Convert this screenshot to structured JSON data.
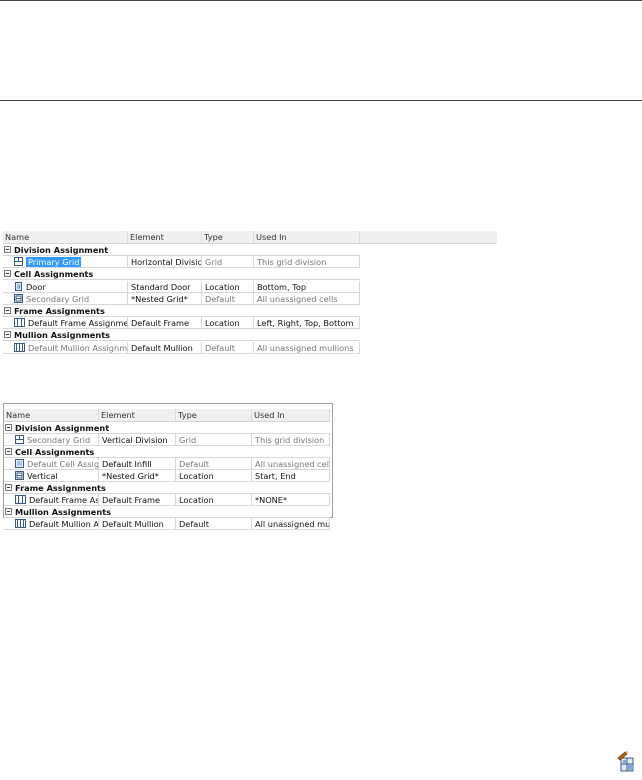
{
  "panel1": {
    "columns": [
      "Name",
      "Element",
      "Type",
      "Used In"
    ],
    "groups": [
      {
        "label": "Division Assignment",
        "rows": [
          {
            "icon": "grid-division-icon",
            "name": "Primary Grid",
            "element": "Horizontal Division",
            "type": "Grid",
            "used_in": "This grid division",
            "selected": true,
            "muted": true
          }
        ]
      },
      {
        "label": "Cell Assignments",
        "rows": [
          {
            "icon": "door-icon",
            "name": "Door",
            "element": "Standard Door",
            "type": "Location",
            "used_in": "Bottom, Top",
            "selected": false,
            "muted": false
          },
          {
            "icon": "nested-grid-icon",
            "name": "Secondary Grid",
            "element": "*Nested Grid*",
            "type": "Default",
            "used_in": "All unassigned cells",
            "selected": false,
            "muted": true
          }
        ]
      },
      {
        "label": "Frame Assignments",
        "rows": [
          {
            "icon": "frame-icon",
            "name": "Default Frame Assignment",
            "element": "Default Frame",
            "type": "Location",
            "used_in": "Left, Right, Top, Bottom",
            "selected": false,
            "muted": false
          }
        ]
      },
      {
        "label": "Mullion Assignments",
        "rows": [
          {
            "icon": "mullion-icon",
            "name": "Default Mullion Assignment",
            "element": "Default Mullion",
            "type": "Default",
            "used_in": "All unassigned mullions",
            "selected": false,
            "muted": true
          }
        ]
      }
    ]
  },
  "panel2": {
    "columns": [
      "Name",
      "Element",
      "Type",
      "Used In"
    ],
    "groups": [
      {
        "label": "Division Assignment",
        "rows": [
          {
            "icon": "grid-division-icon",
            "name": "Secondary Grid",
            "element": "Vertical Division",
            "type": "Grid",
            "used_in": "This grid division",
            "selected": false,
            "muted": true
          }
        ]
      },
      {
        "label": "Cell Assignments",
        "rows": [
          {
            "icon": "cell-icon",
            "name": "Default Cell Assignment",
            "element": "Default Infill",
            "type": "Default",
            "used_in": "All unassigned cells",
            "selected": false,
            "muted": true
          },
          {
            "icon": "nested-grid-icon",
            "name": "Vertical",
            "element": "*Nested Grid*",
            "type": "Location",
            "used_in": "Start, End",
            "selected": false,
            "muted": false
          }
        ]
      },
      {
        "label": "Frame Assignments",
        "rows": [
          {
            "icon": "frame-icon",
            "name": "Default Frame Assign...",
            "element": "Default Frame",
            "type": "Location",
            "used_in": "*NONE*",
            "selected": false,
            "muted": false
          }
        ]
      },
      {
        "label": "Mullion Assignments",
        "rows": [
          {
            "icon": "mullion-icon",
            "name": "Default Mullion Assign...",
            "element": "Default Mullion",
            "type": "Default",
            "used_in": "All unassigned mullions",
            "selected": false,
            "muted": false
          }
        ]
      }
    ]
  },
  "corner_icon": "curtain-wall-tool-icon"
}
